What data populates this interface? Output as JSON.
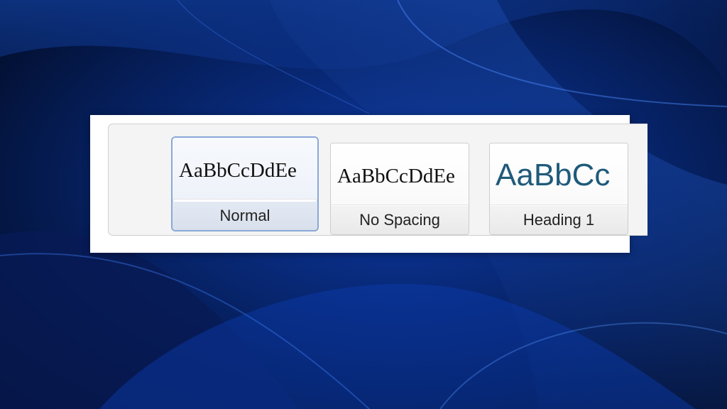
{
  "style_gallery": {
    "selected_style": "Normal",
    "styles": [
      {
        "preview": "AaBbCcDdEe",
        "label": "Normal"
      },
      {
        "preview": "AaBbCcDdEe",
        "label": "No Spacing"
      },
      {
        "preview": "AaBbCc",
        "label": "Heading 1"
      }
    ]
  },
  "colors": {
    "heading_preview": "#1f5a7a",
    "selection_border": "#8aa8d8",
    "wallpaper": "#0a2f8a"
  }
}
